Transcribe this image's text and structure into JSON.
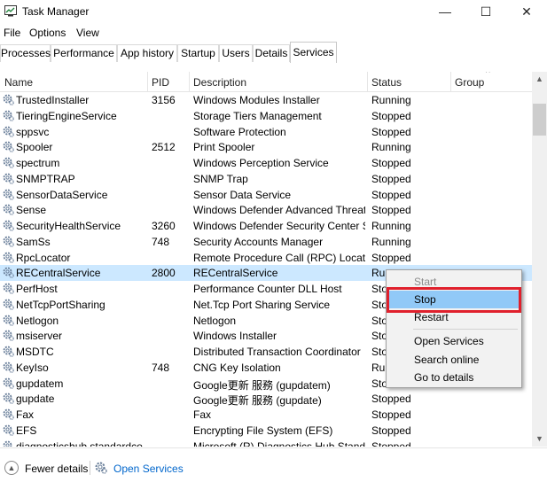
{
  "window": {
    "title": "Task Manager",
    "minimize": "—",
    "maximize": "☐",
    "close": "✕"
  },
  "menu": [
    "File",
    "Options",
    "View"
  ],
  "tabs": [
    "Processes",
    "Performance",
    "App history",
    "Startup",
    "Users",
    "Details",
    "Services"
  ],
  "active_tab": "Services",
  "columns": {
    "name": "Name",
    "pid": "PID",
    "description": "Description",
    "status": "Status",
    "group": "Group"
  },
  "rows": [
    {
      "name": "TrustedInstaller",
      "pid": "3156",
      "desc": "Windows Modules Installer",
      "status": "Running"
    },
    {
      "name": "TieringEngineService",
      "pid": "",
      "desc": "Storage Tiers Management",
      "status": "Stopped"
    },
    {
      "name": "sppsvc",
      "pid": "",
      "desc": "Software Protection",
      "status": "Stopped"
    },
    {
      "name": "Spooler",
      "pid": "2512",
      "desc": "Print Spooler",
      "status": "Running"
    },
    {
      "name": "spectrum",
      "pid": "",
      "desc": "Windows Perception Service",
      "status": "Stopped"
    },
    {
      "name": "SNMPTRAP",
      "pid": "",
      "desc": "SNMP Trap",
      "status": "Stopped"
    },
    {
      "name": "SensorDataService",
      "pid": "",
      "desc": "Sensor Data Service",
      "status": "Stopped"
    },
    {
      "name": "Sense",
      "pid": "",
      "desc": "Windows Defender Advanced Threat...",
      "status": "Stopped"
    },
    {
      "name": "SecurityHealthService",
      "pid": "3260",
      "desc": "Windows Defender Security Center S...",
      "status": "Running"
    },
    {
      "name": "SamSs",
      "pid": "748",
      "desc": "Security Accounts Manager",
      "status": "Running"
    },
    {
      "name": "RpcLocator",
      "pid": "",
      "desc": "Remote Procedure Call (RPC) Locator",
      "status": "Stopped"
    },
    {
      "name": "RECentralService",
      "pid": "2800",
      "desc": "RECentralService",
      "status": "Run"
    },
    {
      "name": "PerfHost",
      "pid": "",
      "desc": "Performance Counter DLL Host",
      "status": "Sto"
    },
    {
      "name": "NetTcpPortSharing",
      "pid": "",
      "desc": "Net.Tcp Port Sharing Service",
      "status": "Sto"
    },
    {
      "name": "Netlogon",
      "pid": "",
      "desc": "Netlogon",
      "status": "Sto"
    },
    {
      "name": "msiserver",
      "pid": "",
      "desc": "Windows Installer",
      "status": "Sto"
    },
    {
      "name": "MSDTC",
      "pid": "",
      "desc": "Distributed Transaction Coordinator",
      "status": "Sto"
    },
    {
      "name": "KeyIso",
      "pid": "748",
      "desc": "CNG Key Isolation",
      "status": "Run"
    },
    {
      "name": "gupdatem",
      "pid": "",
      "desc": "Google更新 服務 (gupdatem)",
      "status": "Sto"
    },
    {
      "name": "gupdate",
      "pid": "",
      "desc": "Google更新 服務 (gupdate)",
      "status": "Stopped"
    },
    {
      "name": "Fax",
      "pid": "",
      "desc": "Fax",
      "status": "Stopped"
    },
    {
      "name": "EFS",
      "pid": "",
      "desc": "Encrypting File System (EFS)",
      "status": "Stopped"
    },
    {
      "name": "diagnosticshub.standardco...",
      "pid": "",
      "desc": "Microsoft (R) Diagnostics Hub Stand...",
      "status": "Stopped"
    }
  ],
  "selected_row": "RECentralService",
  "context_menu": {
    "start": "Start",
    "stop": "Stop",
    "restart": "Restart",
    "open_services": "Open Services",
    "search_online": "Search online",
    "go_to_details": "Go to details"
  },
  "footer": {
    "fewer_details": "Fewer details",
    "open_services": "Open Services"
  },
  "colors": {
    "selection": "#cce8ff",
    "menu_hover": "#91c9f7",
    "highlight": "#e0202c",
    "link": "#0066cc"
  },
  "icons": {
    "app": "task-manager-icon",
    "service": "gear-icon"
  }
}
